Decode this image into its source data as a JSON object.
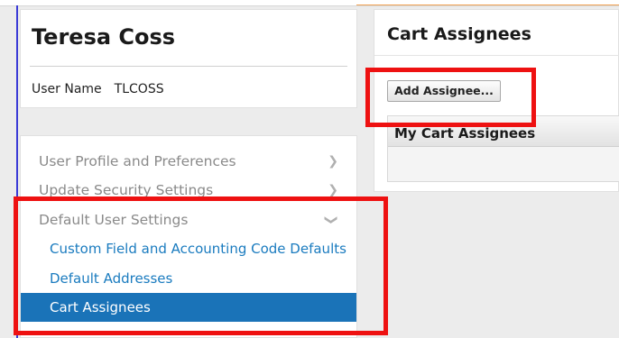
{
  "user": {
    "full_name": "Teresa Coss",
    "username_label": "User Name",
    "username_value": "TLCOSS"
  },
  "menu": {
    "items": [
      {
        "label": "User Profile and Preferences",
        "chevron": "chevron-right-icon"
      },
      {
        "label": "Update Security Settings",
        "chevron": "chevron-right-icon"
      },
      {
        "label": "Default User Settings",
        "chevron": "chevron-down-icon"
      }
    ],
    "sub_items": [
      {
        "label": "Custom Field and Accounting Code Defaults",
        "active": false
      },
      {
        "label": "Default Addresses",
        "active": false
      },
      {
        "label": "Cart Assignees",
        "active": true
      }
    ]
  },
  "panel": {
    "title": "Cart Assignees",
    "add_button_label": "Add Assignee...",
    "section_header": "My Cart Assignees"
  },
  "colors": {
    "link": "#1a7bbf",
    "active_bg": "#1a73b8",
    "highlight": "#ee1111"
  }
}
